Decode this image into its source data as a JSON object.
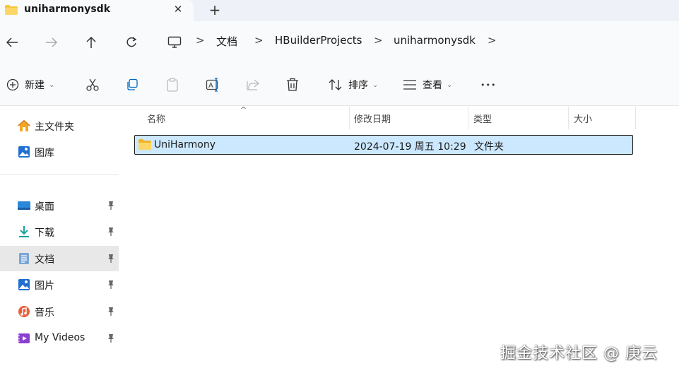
{
  "tab": {
    "title": "uniharmonysdk",
    "close_glyph": "✕",
    "new_tab_glyph": "+"
  },
  "breadcrumb": {
    "separator": ">",
    "items": [
      "文档",
      "HBuilderProjects",
      "uniharmonysdk"
    ]
  },
  "toolbar": {
    "new_label": "新建",
    "sort_label": "排序",
    "view_label": "查看",
    "more_glyph": "•••",
    "caret": "⌄"
  },
  "sidebar": {
    "items": [
      {
        "label": "主文件夹",
        "icon": "home-icon"
      },
      {
        "label": "图库",
        "icon": "gallery-icon"
      },
      {
        "label": "桌面",
        "icon": "desktop-icon",
        "pinned": true
      },
      {
        "label": "下载",
        "icon": "download-icon",
        "pinned": true
      },
      {
        "label": "文档",
        "icon": "documents-icon",
        "pinned": true,
        "selected": true
      },
      {
        "label": "图片",
        "icon": "pictures-icon",
        "pinned": true
      },
      {
        "label": "音乐",
        "icon": "music-icon",
        "pinned": true
      },
      {
        "label": "My Videos",
        "icon": "videos-icon",
        "pinned": true
      }
    ]
  },
  "file_list": {
    "columns": [
      "名称",
      "修改日期",
      "类型",
      "大小"
    ],
    "sort_indicator": "^",
    "rows": [
      {
        "name": "UniHarmony",
        "modified": "2024-07-19 周五 10:29",
        "type": "文件夹",
        "size": "",
        "selected": true
      }
    ]
  },
  "watermark": "掘金技术社区 @ 庚云",
  "colors": {
    "accent": "#0067c0",
    "selection": "#cce8ff",
    "folder": "#f8c83c",
    "chrome": "#f9fafc"
  }
}
